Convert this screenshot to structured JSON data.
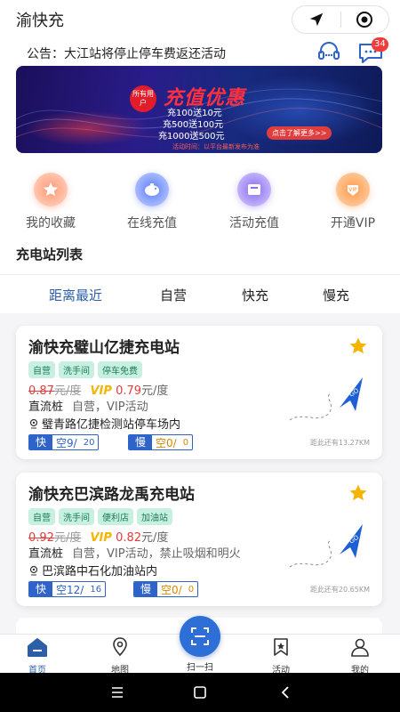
{
  "app_title": "渝快充",
  "notice": {
    "text": "公告：大江站将停止停车费返还活动",
    "badge": "34"
  },
  "banner": {
    "tag": "所有用户",
    "title": "充值优惠",
    "lines": [
      "充100送10元",
      "充500送100元",
      "充1000送500元"
    ],
    "button": "点击了解更多>>",
    "footnote": "活动时间：以平台最新发布为准"
  },
  "quick_actions": [
    {
      "label": "我的收藏",
      "icon": "star-icon"
    },
    {
      "label": "在线充值",
      "icon": "piggy-bank-icon"
    },
    {
      "label": "活动充值",
      "icon": "gift-card-icon"
    },
    {
      "label": "开通VIP",
      "icon": "vip-icon"
    }
  ],
  "section_title": "充电站列表",
  "tabs": [
    "距离最近",
    "自营",
    "快充",
    "慢充"
  ],
  "stations": [
    {
      "name": "渝快充璧山亿捷充电站",
      "tags": [
        "自营",
        "洗手间",
        "停车免费"
      ],
      "old_price": "0.87",
      "old_unit": "元/度",
      "vip_label": "VIP",
      "new_price": "0.79",
      "new_unit": "元/度",
      "type": "直流桩",
      "features": "自营，VIP活动",
      "address": "璧青路亿捷检测站停车场内",
      "fast_label": "快",
      "fast_free": "空9/",
      "fast_total": "20",
      "slow_label": "慢",
      "slow_free": "空0/",
      "slow_total": "0",
      "distance": "距此还有13.27KM"
    },
    {
      "name": "渝快充巴滨路龙禹充电站",
      "tags": [
        "自营",
        "洗手间",
        "便利店",
        "加油站"
      ],
      "old_price": "0.92",
      "old_unit": "元/度",
      "vip_label": "VIP",
      "new_price": "0.82",
      "new_unit": "元/度",
      "type": "直流桩",
      "features": "自营，VIP活动，禁止吸烟和明火",
      "address": "巴滨路中石化加油站内",
      "fast_label": "快",
      "fast_free": "空12/",
      "fast_total": "16",
      "slow_label": "慢",
      "slow_free": "空0/",
      "slow_total": "0",
      "distance": "距此还有20.65KM"
    }
  ],
  "go_label": "GO",
  "tabbar": [
    {
      "label": "首页",
      "icon": "home-icon",
      "active": true
    },
    {
      "label": "地图",
      "icon": "map-pin-icon"
    },
    {
      "label": "扫一扫",
      "icon": "scan-icon"
    },
    {
      "label": "活动",
      "icon": "activity-icon"
    },
    {
      "label": "我的",
      "icon": "user-icon"
    }
  ],
  "colors": {
    "primary": "#2d5fa8",
    "accent": "#2d6fd6",
    "price": "#e23c3c",
    "vip": "#f4b400",
    "tag_bg": "#c8f0e1"
  }
}
